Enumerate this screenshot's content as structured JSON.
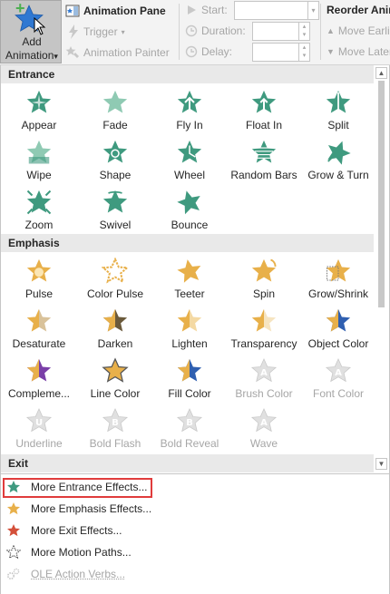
{
  "ribbon": {
    "add_animation_l1": "Add",
    "add_animation_l2": "Animation",
    "add_animation_caret": "▾",
    "animation_pane": "Animation Pane",
    "trigger": "Trigger",
    "animation_painter": "Animation Painter",
    "start": "Start:",
    "duration": "Duration:",
    "delay": "Delay:",
    "reorder": "Reorder Animation",
    "move_earlier": "Move Earlier",
    "move_later": "Move Later"
  },
  "gallery": {
    "entrance_header": "Entrance",
    "emphasis_header": "Emphasis",
    "exit_header": "Exit",
    "entrance": [
      "Appear",
      "Fade",
      "Fly In",
      "Float In",
      "Split",
      "Wipe",
      "Shape",
      "Wheel",
      "Random Bars",
      "Grow & Turn",
      "Zoom",
      "Swivel",
      "Bounce"
    ],
    "emphasis": [
      "Pulse",
      "Color Pulse",
      "Teeter",
      "Spin",
      "Grow/Shrink",
      "Desaturate",
      "Darken",
      "Lighten",
      "Transparency",
      "Object Color",
      "Compleme...",
      "Line Color",
      "Fill Color",
      "Brush Color",
      "Font Color",
      "Underline",
      "Bold Flash",
      "Bold Reveal",
      "Wave"
    ]
  },
  "menu": {
    "more_entrance": "More Entrance Effects...",
    "more_emphasis": "More Emphasis Effects...",
    "more_exit": "More Exit Effects...",
    "more_motion": "More Motion Paths...",
    "ole": "OLE Action Verbs..."
  },
  "colors": {
    "entrance_green": "#3f9a7f",
    "emphasis_gold": "#e8b04a",
    "exit_red": "#d4503a",
    "highlight_red": "#e03c3c",
    "disabled_gray": "#a6a6a6"
  }
}
